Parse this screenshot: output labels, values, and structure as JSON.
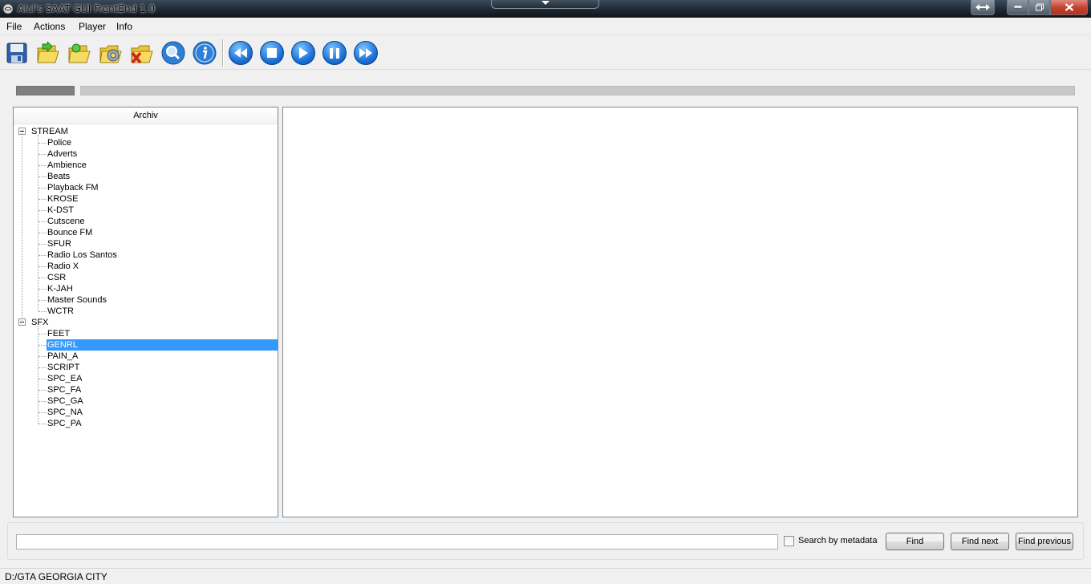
{
  "window": {
    "title": "Alci's SAAT GUI FrontEnd 1.0"
  },
  "menu": [
    "File",
    "Actions",
    "Player",
    "Info"
  ],
  "toolbar": {
    "file_buttons": [
      "save-icon",
      "open-folder-icon",
      "open-folder-green-icon",
      "folder-settings-icon",
      "folder-close-icon",
      "search-icon",
      "info-icon"
    ],
    "media_buttons": [
      "rewind-icon",
      "stop-icon",
      "play-icon",
      "pause-icon",
      "fast-forward-icon"
    ]
  },
  "tree": {
    "header": "Archiv",
    "groups": [
      {
        "label": "STREAM",
        "children": [
          "Police",
          "Adverts",
          "Ambience",
          "Beats",
          "Playback FM",
          "KROSE",
          "K-DST",
          "Cutscene",
          "Bounce FM",
          "SFUR",
          "Radio Los Santos",
          "Radio X",
          "CSR",
          "K-JAH",
          "Master Sounds",
          "WCTR"
        ]
      },
      {
        "label": "SFX",
        "children": [
          "FEET",
          "GENRL",
          "PAIN_A",
          "SCRIPT",
          "SPC_EA",
          "SPC_FA",
          "SPC_GA",
          "SPC_NA",
          "SPC_PA"
        ]
      }
    ],
    "selected": "GENRL"
  },
  "search": {
    "value": "",
    "metadata_label": "Search by metadata",
    "metadata_checked": false,
    "find_label": "Find",
    "find_next_label": "Find next",
    "find_previous_label": "Find previous"
  },
  "status": {
    "path": "D:/GTA GEORGIA CITY"
  },
  "colors": {
    "selection": "#3399ff",
    "media_button": "#1d72d8"
  }
}
